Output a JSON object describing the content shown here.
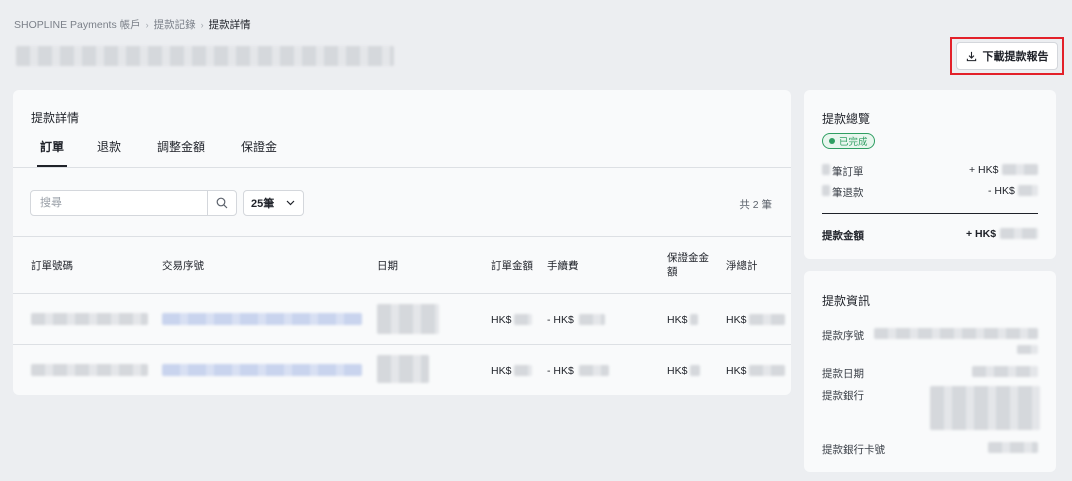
{
  "breadcrumb": {
    "item1": "SHOPLINE Payments 帳戶",
    "item2": "提款記錄",
    "current": "提款詳情"
  },
  "header": {
    "download_label": "下載提款報告"
  },
  "main": {
    "title": "提款詳情",
    "tabs": [
      "訂單",
      "退款",
      "調整金額",
      "保證金"
    ],
    "search_placeholder": "搜尋",
    "page_size": "25筆",
    "total": "共 2 筆",
    "columns": [
      "訂單號碼",
      "交易序號",
      "日期",
      "訂單金額",
      "手續費",
      "保證金金額",
      "淨總計"
    ],
    "rows": [
      {
        "amount": "HK$",
        "fee": "- HK$",
        "deposit": "HK$",
        "net": "HK$"
      },
      {
        "amount": "HK$",
        "fee": "- HK$",
        "deposit": "HK$",
        "net": "HK$"
      }
    ]
  },
  "summary": {
    "title": "提款總覽",
    "status": "已完成",
    "orders_label": "筆訂單",
    "orders_value": "+ HK$",
    "refunds_label": "筆退款",
    "refunds_value": "- HK$",
    "total_label": "提款金額",
    "total_value": "+ HK$"
  },
  "info": {
    "title": "提款資訊",
    "serial_label": "提款序號",
    "date_label": "提款日期",
    "bank_label": "提款銀行",
    "card_label": "提款銀行卡號"
  },
  "colors": {
    "accent_red": "#e3212a",
    "success_green": "#2f9e62",
    "link_blue": "#3b6fd6"
  }
}
